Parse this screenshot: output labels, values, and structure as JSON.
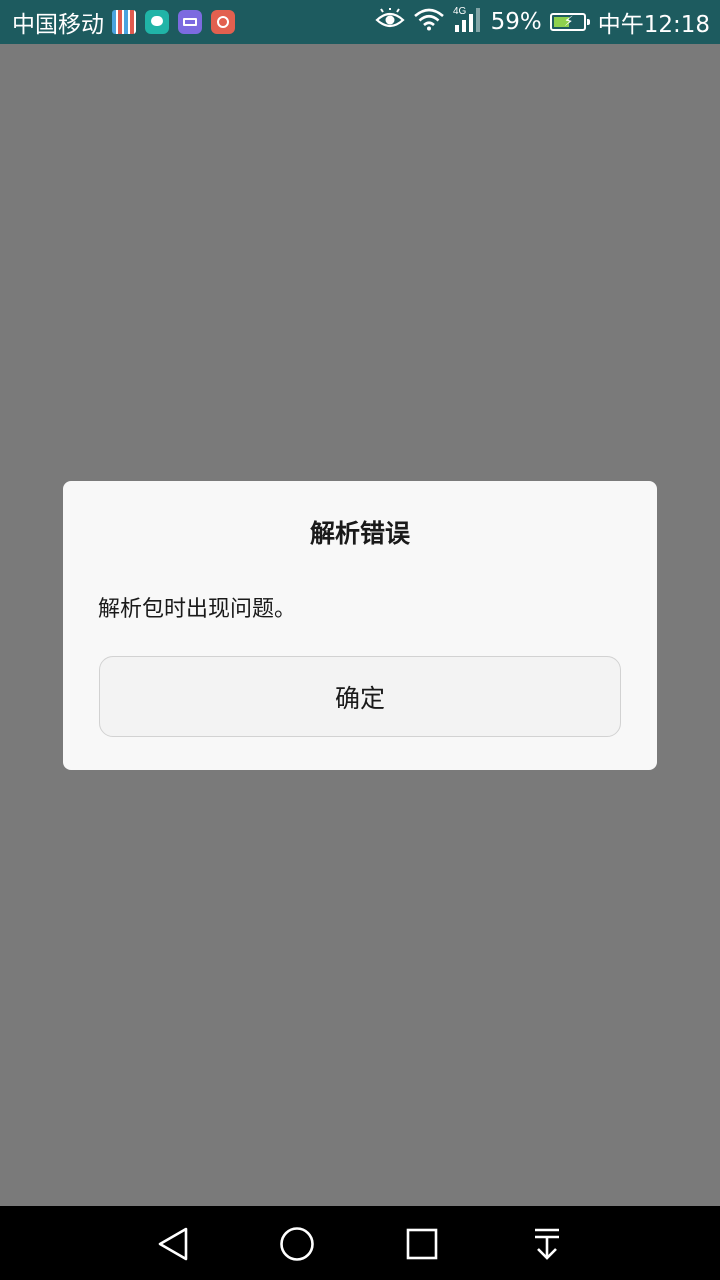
{
  "status_bar": {
    "carrier": "中国移动",
    "network_type": "4G",
    "battery_percent": "59%",
    "battery_level": 0.59,
    "time": "中午12:18",
    "background_color": "#1d5b5f",
    "notification_icons": [
      "qr-app-icon",
      "chat-icon",
      "keyboard-icon",
      "app-icon"
    ],
    "system_icons": [
      "eye-comfort-icon",
      "wifi-icon",
      "signal-icon",
      "battery-icon"
    ]
  },
  "dialog": {
    "title": "解析错误",
    "message": "解析包时出现问题。",
    "confirm_label": "确定"
  },
  "nav_bar": {
    "buttons": [
      "back-icon",
      "home-icon",
      "recents-icon",
      "notification-pull-icon"
    ]
  },
  "colors": {
    "scrim": "#7a7a7a",
    "dialog_bg": "#f8f8f8",
    "nav_bg": "#000000"
  }
}
